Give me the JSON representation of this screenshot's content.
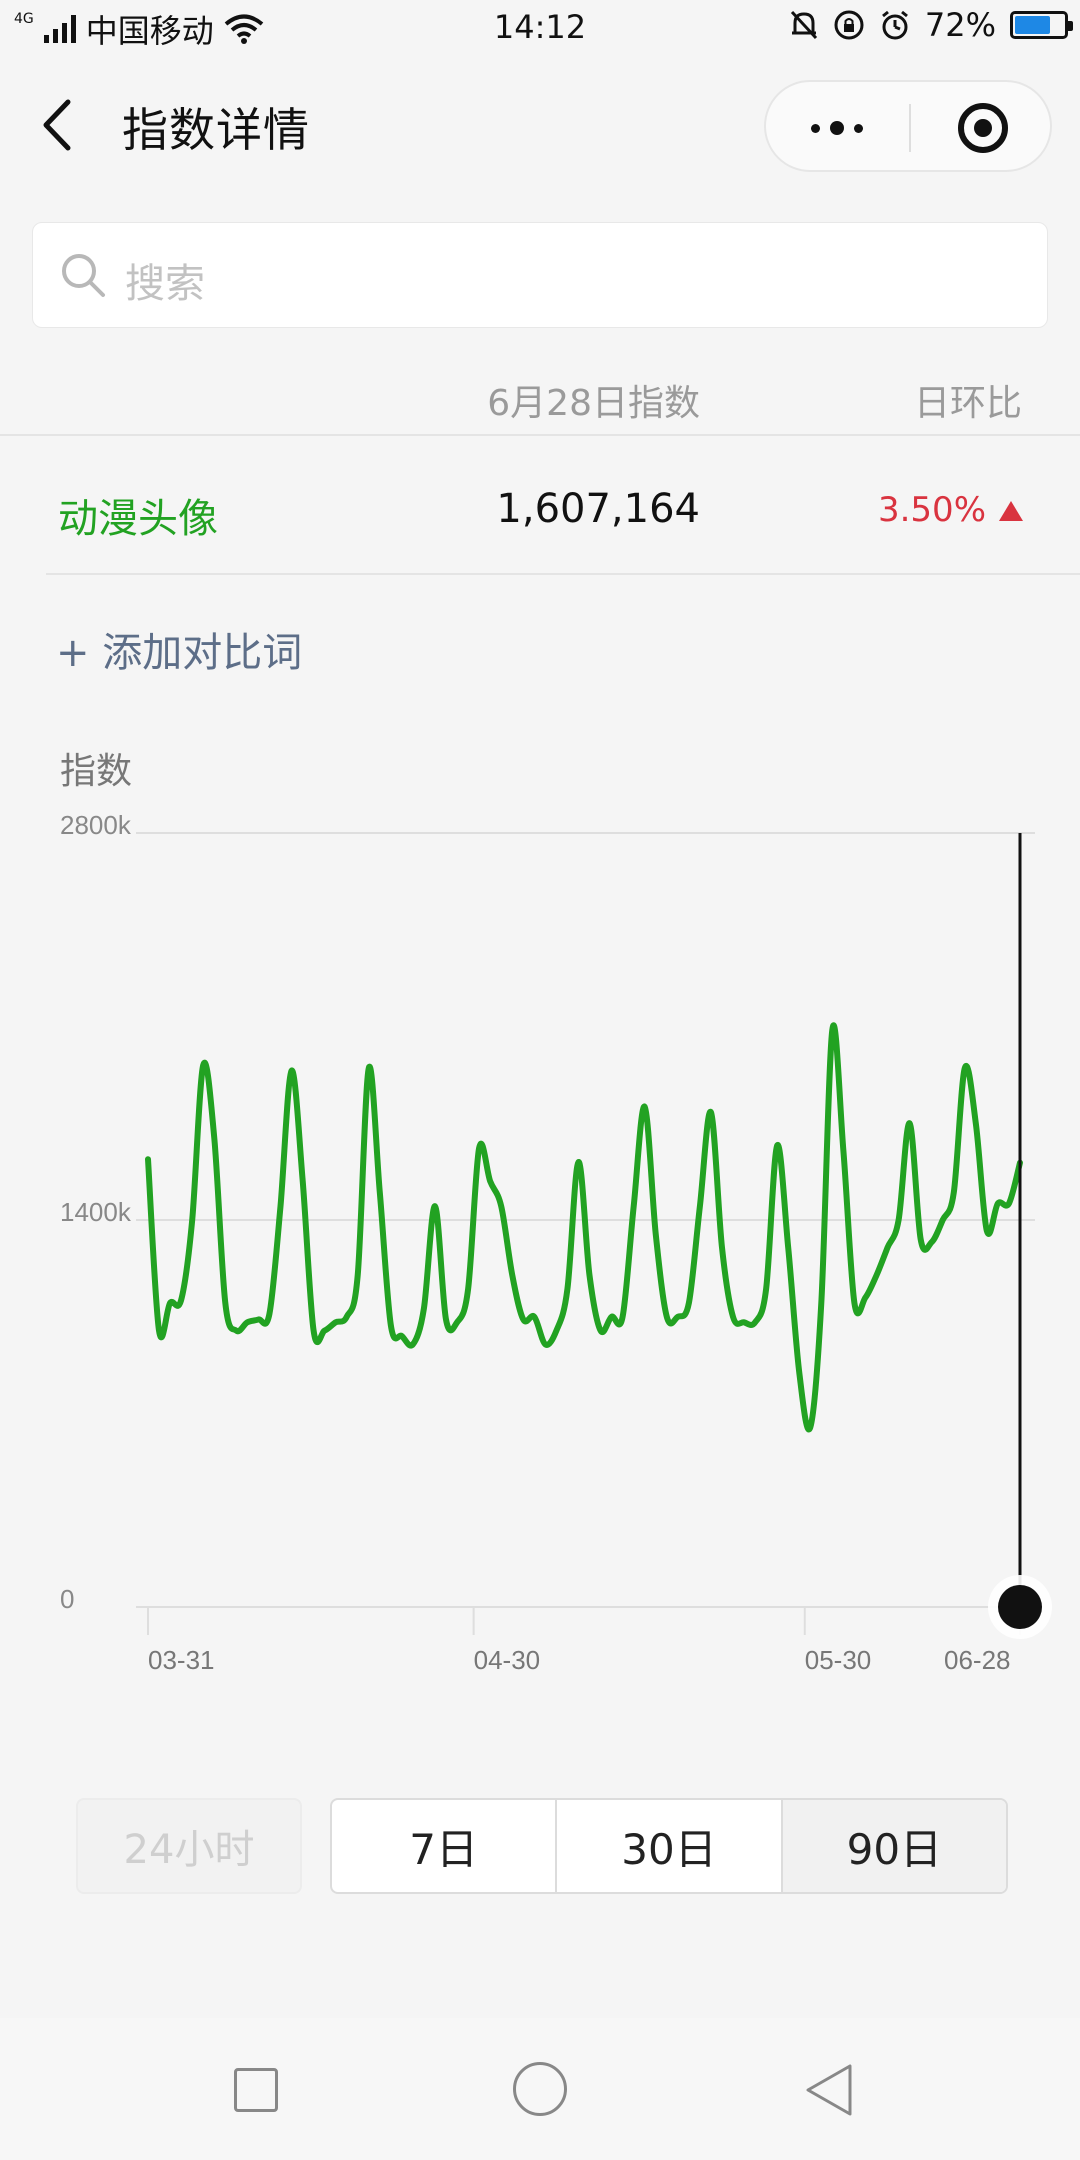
{
  "status_bar": {
    "network_tag": "4G",
    "carrier": "中国移动",
    "time": "14:12",
    "battery": "72%",
    "battery_fraction": 0.72
  },
  "navbar": {
    "title": "指数详情"
  },
  "search": {
    "placeholder": "搜索"
  },
  "table": {
    "col_date": "6月28日指数",
    "col_ratio": "日环比",
    "row": {
      "keyword": "动漫头像",
      "value": "1,607,164",
      "ratio": "3.50%"
    }
  },
  "add_compare": "+ 添加对比词",
  "chart_data": {
    "type": "line",
    "ylabel": "指数",
    "ylim": [
      0,
      2800000
    ],
    "y_ticks": [
      "2800k",
      "1400k",
      "0"
    ],
    "x_ticks": [
      "03-31",
      "04-30",
      "05-30",
      "06-28"
    ],
    "line_color": "#22a222",
    "grid": true,
    "series": [
      {
        "values": [
          1620000,
          1000000,
          1100000,
          1110000,
          1400000,
          1960000,
          1700000,
          1100000,
          1000000,
          1030000,
          1040000,
          1060000,
          1450000,
          1940000,
          1550000,
          1000000,
          1000000,
          1030000,
          1050000,
          1200000,
          1950000,
          1500000,
          1020000,
          980000,
          950000,
          1080000,
          1450000,
          1040000,
          1030000,
          1150000,
          1660000,
          1540000,
          1450000,
          1200000,
          1040000,
          1050000,
          950000,
          1000000,
          1150000,
          1610000,
          1200000,
          1000000,
          1050000,
          1050000,
          1450000,
          1810000,
          1350000,
          1050000,
          1050000,
          1100000,
          1450000,
          1790000,
          1300000,
          1050000,
          1030000,
          1030000,
          1150000,
          1670000,
          1300000,
          850000,
          650000,
          1100000,
          2090000,
          1650000,
          1100000,
          1120000,
          1200000,
          1300000,
          1400000,
          1750000,
          1330000,
          1320000,
          1400000,
          1500000,
          1950000,
          1750000,
          1360000,
          1460000,
          1460000,
          1607164
        ]
      }
    ],
    "selected_index": 79
  },
  "range_buttons": {
    "r24h": "24小时",
    "r7d": "7日",
    "r30d": "30日",
    "r90d": "90日"
  }
}
